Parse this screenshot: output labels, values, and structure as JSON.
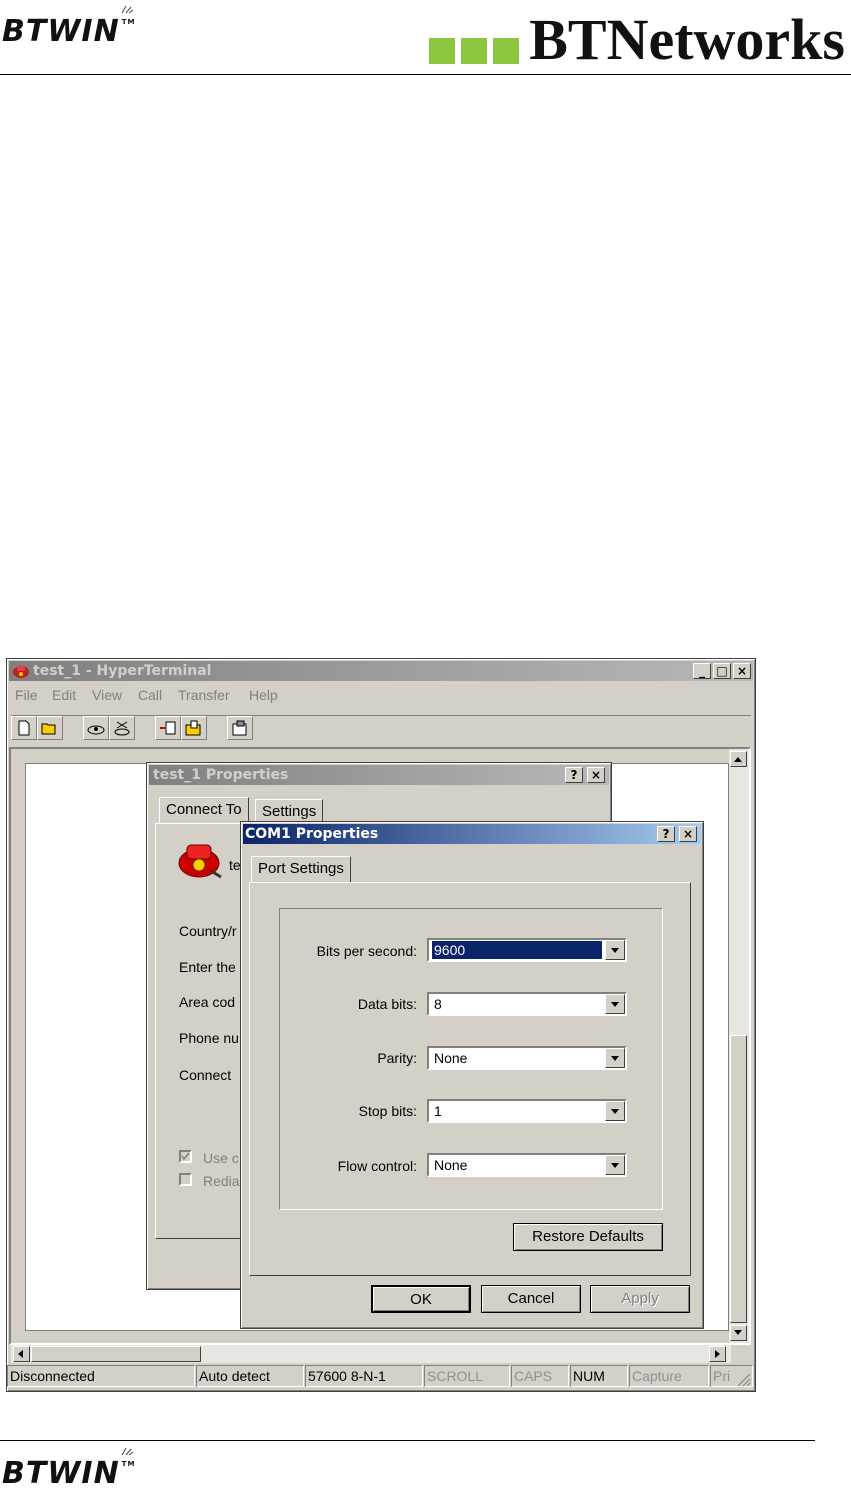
{
  "header": {
    "left_logo": "BTWIN",
    "tm": "TM",
    "right_logo": "BTNetworks"
  },
  "footer": {
    "logo": "BTWIN",
    "tm": "TM"
  },
  "hyperterminal": {
    "title": "test_1 - HyperTerminal",
    "menu": [
      "File",
      "Edit",
      "View",
      "Call",
      "Transfer",
      "Help"
    ],
    "toolbar_icons": [
      "new-icon",
      "open-icon",
      "dial-icon",
      "disconnect-icon",
      "send-icon",
      "receive-icon",
      "properties-icon"
    ],
    "status": [
      "Disconnected",
      "Auto detect",
      "57600 8-N-1",
      "SCROLL",
      "CAPS",
      "NUM",
      "Capture",
      "Pri"
    ]
  },
  "properties_dialog": {
    "title": "test_1 Properties",
    "tabs": [
      "Connect To",
      "Settings"
    ],
    "name_fragment": "te",
    "labels": [
      "Country/r",
      "Enter the",
      "Area cod",
      "Phone nu",
      "Connect"
    ],
    "checkboxes": [
      "Use c",
      "Redia"
    ]
  },
  "com_dialog": {
    "title": "COM1 Properties",
    "tab": "Port Settings",
    "fields": [
      {
        "label": "Bits per second:",
        "value": "9600"
      },
      {
        "label": "Data bits:",
        "value": "8"
      },
      {
        "label": "Parity:",
        "value": "None"
      },
      {
        "label": "Stop bits:",
        "value": "1"
      },
      {
        "label": "Flow control:",
        "value": "None"
      }
    ],
    "restore_label": "Restore Defaults",
    "ok_label": "OK",
    "cancel_label": "Cancel",
    "apply_label": "Apply"
  }
}
